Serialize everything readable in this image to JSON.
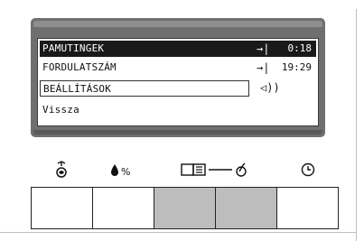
{
  "screen": {
    "rows": [
      {
        "label": "PAMUTINGEK",
        "arrow": "→|",
        "time": "0:18"
      },
      {
        "label": "FORDULATSZÁM",
        "arrow": "→|",
        "time": "19:29"
      },
      {
        "label": "BEÁLLÍTÁSOK",
        "sound": "◁))"
      },
      {
        "label": "Vissza"
      }
    ]
  },
  "icons": [
    {
      "name": "stain-icon",
      "glyph": "♉"
    },
    {
      "name": "humidity-percent-icon",
      "glyph": "🌢%"
    },
    {
      "name": "book-check-icon",
      "glyph": "📖—✓"
    },
    {
      "name": "clock-icon",
      "glyph": "◷"
    }
  ],
  "keys": [
    {
      "shaded": false
    },
    {
      "shaded": false
    },
    {
      "shaded": true
    },
    {
      "shaded": true
    },
    {
      "shaded": false
    }
  ]
}
